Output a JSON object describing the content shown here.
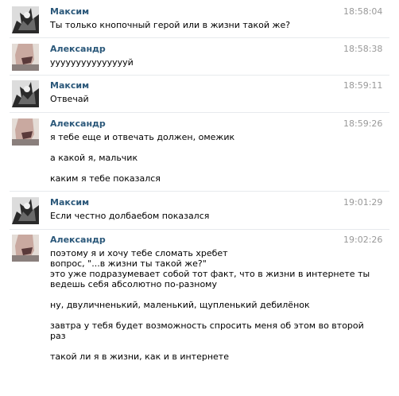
{
  "messages": [
    {
      "author": "Максим",
      "time": "18:58:04",
      "avatar": "avatar-maxim",
      "groups": [
        [
          "Ты только кнопочный герой или в жизни такой же?"
        ]
      ]
    },
    {
      "author": "Александр",
      "time": "18:58:38",
      "avatar": "avatar-alexander",
      "groups": [
        [
          "уууууууууууууууй"
        ]
      ]
    },
    {
      "author": "Максим",
      "time": "18:59:11",
      "avatar": "avatar-maxim",
      "groups": [
        [
          "Отвечай"
        ]
      ]
    },
    {
      "author": "Александр",
      "time": "18:59:26",
      "avatar": "avatar-alexander",
      "groups": [
        [
          "я тебе еще и отвечать должен, омежик"
        ],
        [
          "а какой я, мальчик"
        ],
        [
          "каким я тебе показался"
        ]
      ]
    },
    {
      "author": "Максим",
      "time": "19:01:29",
      "avatar": "avatar-maxim",
      "groups": [
        [
          "Если честно долбаебом показался"
        ]
      ]
    },
    {
      "author": "Александр",
      "time": "19:02:26",
      "avatar": "avatar-alexander",
      "groups": [
        [
          "поэтому я и хочу тебе сломать хребет",
          "вопрос, \"...в жизни ты такой же?\"",
          "это уже подразумевает собой тот факт, что в жизни в интернете ты",
          "ведешь себя абсолютно по-разному"
        ],
        [
          "ну, двуличненький, маленький, щупленький дебилёнок"
        ],
        [
          "завтра у тебя будет возможность спросить меня об этом во второй",
          "раз"
        ],
        [
          "такой ли я в жизни, как и в интернете"
        ]
      ]
    }
  ]
}
